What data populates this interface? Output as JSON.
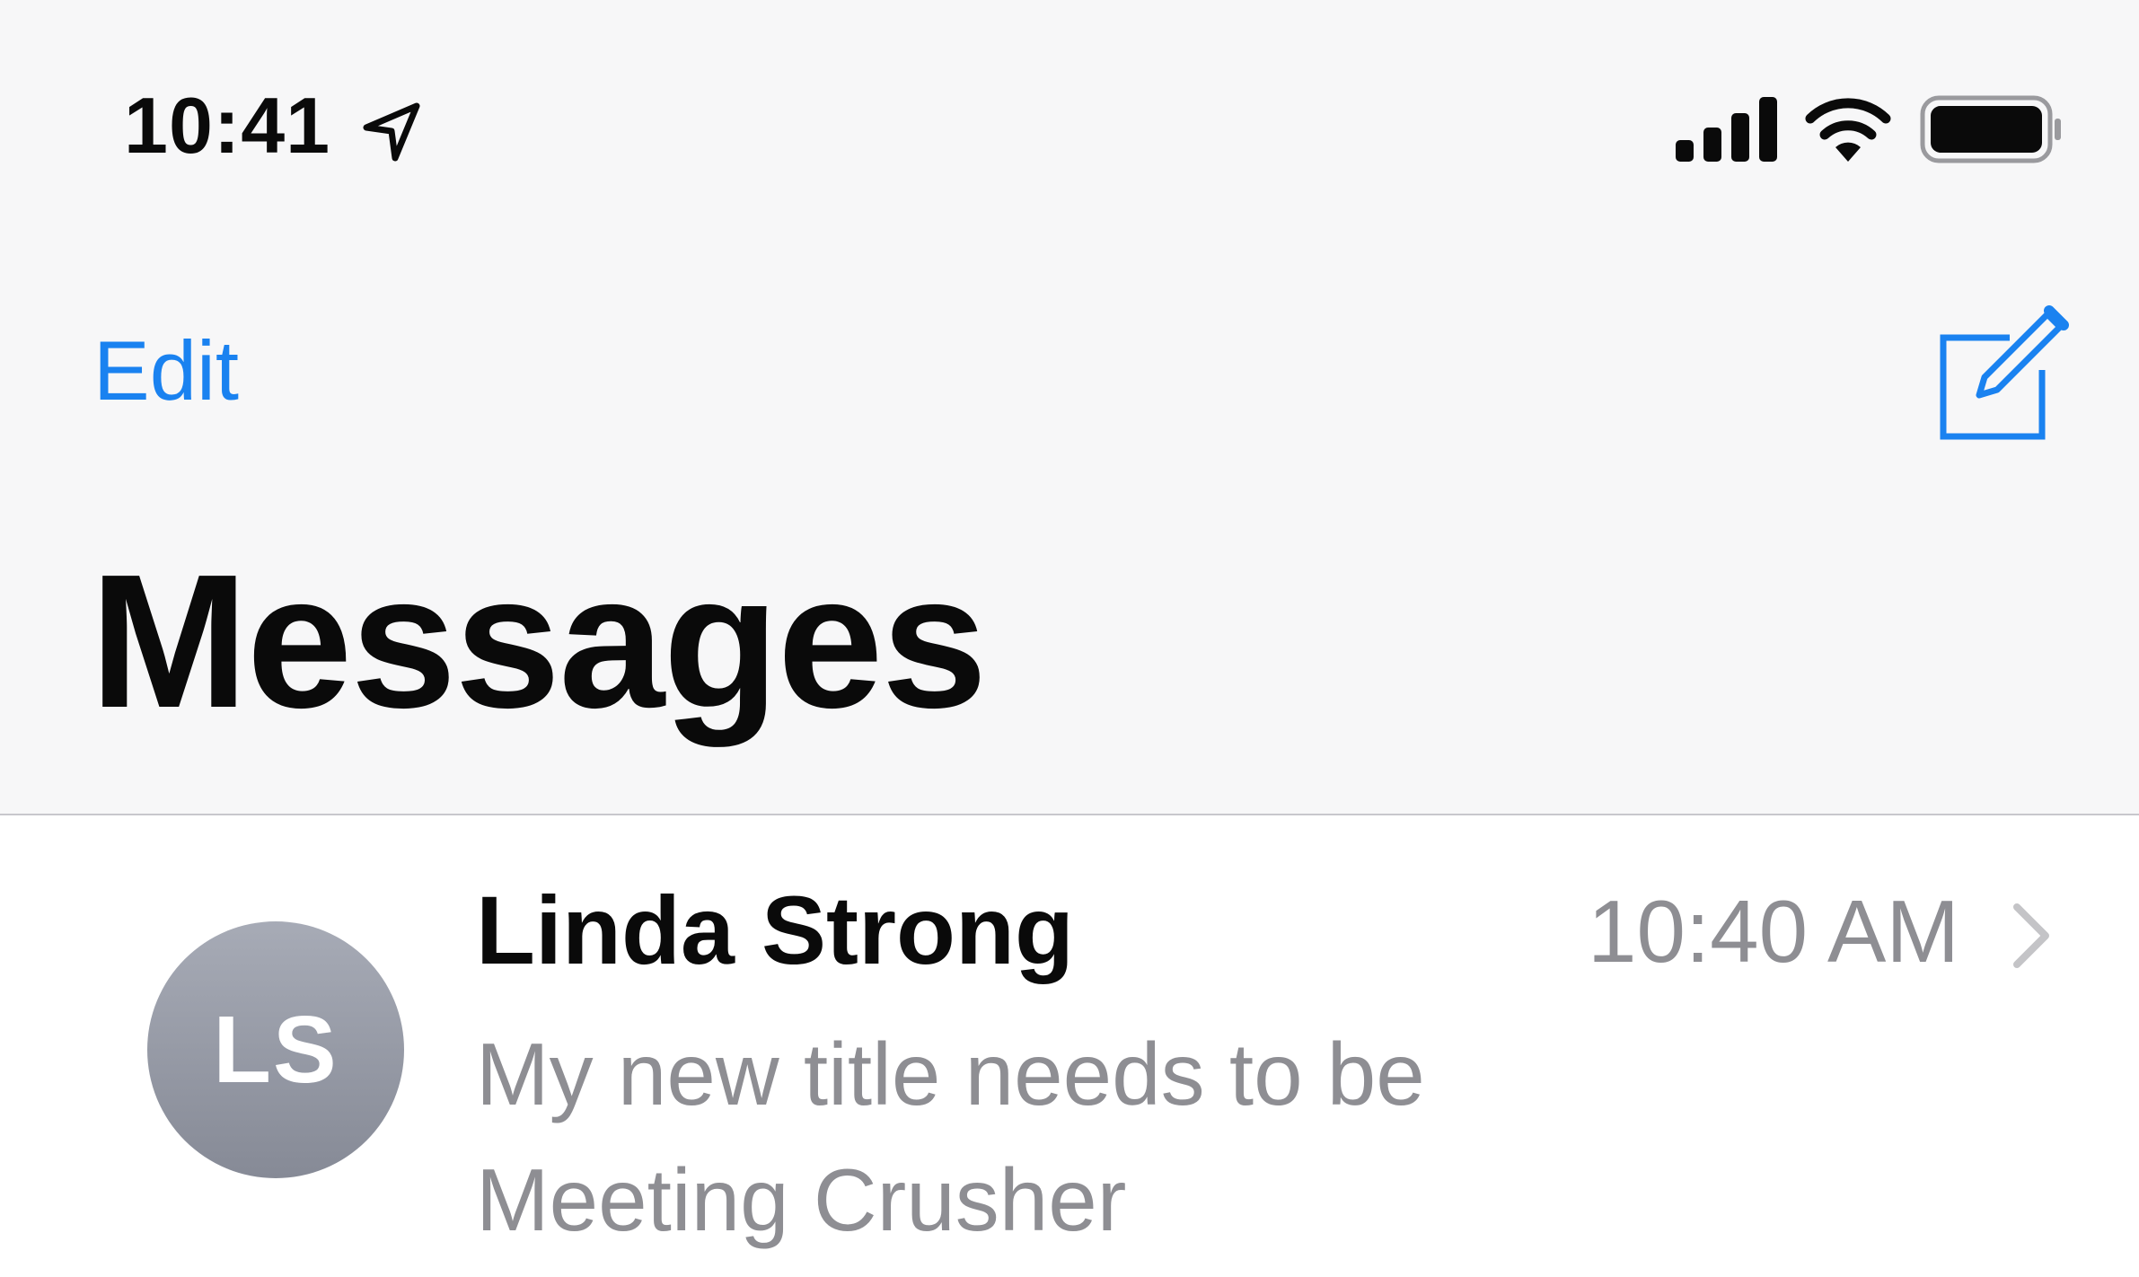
{
  "status_bar": {
    "time": "10:41",
    "icons": [
      "location-arrow-icon",
      "cellular-signal-icon",
      "wifi-icon",
      "battery-icon"
    ]
  },
  "nav_bar": {
    "edit_label": "Edit",
    "compose_icon": "compose-icon",
    "accent_color": "#1a82f0"
  },
  "page": {
    "title": "Messages"
  },
  "conversations": [
    {
      "initials": "LS",
      "name": "Linda Strong",
      "time": "10:40 AM",
      "preview": "My new title needs to be Meeting Crusher"
    }
  ]
}
